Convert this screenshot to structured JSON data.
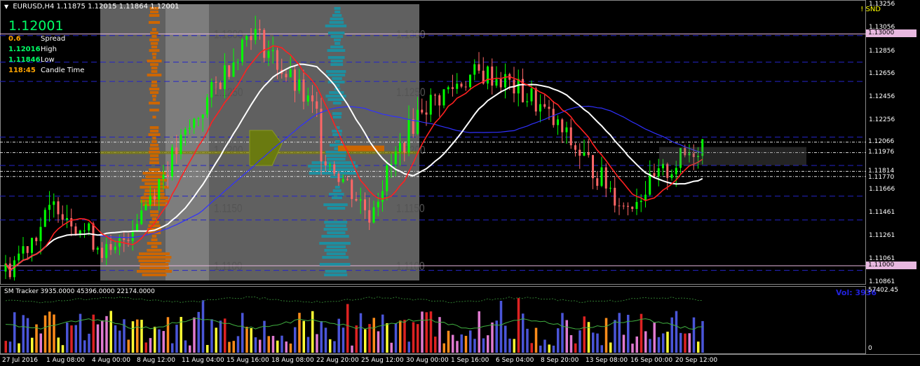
{
  "header": {
    "symbol": "EURUSD,H4",
    "open": "1.11875",
    "high": "1.12015",
    "low": "1.11864",
    "close": "1.12001"
  },
  "info_panel": {
    "current_price": "1.12001",
    "rows": [
      {
        "value": "0.6",
        "label": "Spread",
        "color": "#ffa500"
      },
      {
        "value": "1.12016",
        "label": "High",
        "color": "#00ff66"
      },
      {
        "value": "1.11846",
        "label": "Low",
        "color": "#00ff66"
      },
      {
        "value": "118:45",
        "label": "Candle Time",
        "color": "#ffa500"
      }
    ]
  },
  "snd_flag": "! SND",
  "profile_overlay_labels": [
    "1.1300",
    "1.1250",
    "1.1200",
    "1.1150",
    "1.1100"
  ],
  "price_axis": {
    "labels": [
      "1.13256",
      "1.13056",
      "1.12856",
      "1.12656",
      "1.12456",
      "1.12256",
      "1.11666",
      "1.11461",
      "1.11261",
      "1.11061",
      "1.10861"
    ],
    "boxes": [
      {
        "text": "1.13000",
        "bg": "#e8b8e0"
      },
      {
        "text": "1.12066",
        "bg": "#000000",
        "fg": "#ffffff"
      },
      {
        "text": "1.11976",
        "bg": "#000000",
        "fg": "#ffffff"
      },
      {
        "text": "1.11814",
        "bg": "#000000",
        "fg": "#ffffff"
      },
      {
        "text": "1.11770",
        "bg": "#000000",
        "fg": "#ffffff"
      },
      {
        "text": "1.11000",
        "bg": "#e8b8e0"
      }
    ]
  },
  "volume_pane": {
    "title": "SM Tracker 3935.0000 45396.0000 22174.0000",
    "readout": "Vol: 3936",
    "axis_top": "57402.45",
    "axis_bottom": "0"
  },
  "time_axis": [
    "27 Jul 2016",
    "1 Aug 08:00",
    "4 Aug 00:00",
    "8 Aug 12:00",
    "11 Aug 04:00",
    "15 Aug 16:00",
    "18 Aug 08:00",
    "22 Aug 20:00",
    "25 Aug 12:00",
    "30 Aug 00:00",
    "1 Sep 16:00",
    "6 Sep 04:00",
    "8 Sep 20:00",
    "13 Sep 08:00",
    "16 Sep 00:00",
    "20 Sep 12:00"
  ],
  "colors": {
    "bull": "#00ff00",
    "bear": "#ff6666",
    "ma_red": "#ff2020",
    "ma_white": "#ffffff",
    "ma_blue": "#3030ff",
    "profile_orange": "#cc6600",
    "profile_teal": "#1e8fa0",
    "profile_bg": "#808080"
  }
}
